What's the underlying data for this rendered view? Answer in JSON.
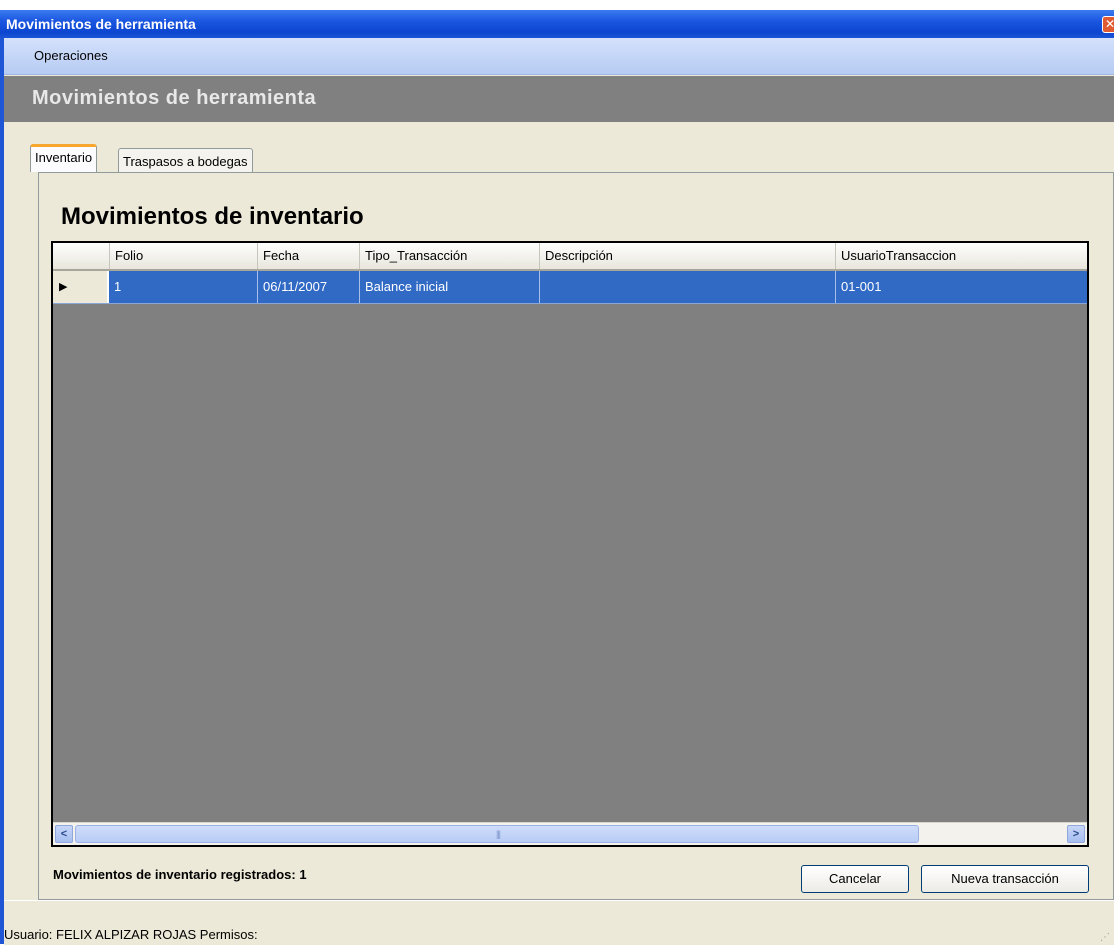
{
  "window": {
    "title": "Movimientos de herramienta",
    "close_glyph": "✕"
  },
  "menu": {
    "items": [
      "Operaciones"
    ]
  },
  "banner": {
    "title": "Movimientos de herramienta"
  },
  "tabs": [
    {
      "label": "Inventario",
      "active": true
    },
    {
      "label": "Traspasos a bodegas",
      "active": false
    }
  ],
  "section": {
    "title": "Movimientos de inventario"
  },
  "grid": {
    "columns": [
      "Folio",
      "Fecha",
      "Tipo_Transacción",
      "Descripción",
      "UsuarioTransaccion"
    ],
    "rows": [
      {
        "folio": "1",
        "fecha": "06/11/2007",
        "tipo": "Balance inicial",
        "descripcion": "",
        "usuario": "01-001",
        "selected": true
      }
    ],
    "selection_color": "#316ac5",
    "empty_area_color": "#808080"
  },
  "footer": {
    "count_label": "Movimientos de inventario registrados:  1",
    "cancel_label": "Cancelar",
    "new_label": "Nueva transacción"
  },
  "status": {
    "text": "Usuario: FELIX ALPIZAR ROJAS  Permisos:"
  },
  "icons": {
    "row_pointer": "triangle-right-icon",
    "scroll_left": "chevron-left-icon",
    "scroll_right": "chevron-right-icon",
    "close": "close-icon"
  }
}
